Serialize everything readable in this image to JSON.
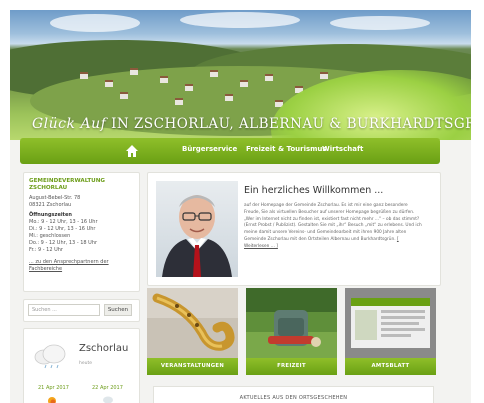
{
  "header": {
    "title_script": "Glück Auf",
    "title_rest": "in Zschorlau, Albernau & Burkhardtsgrün"
  },
  "nav": {
    "home_icon": "home-icon",
    "items": [
      "Bürgerservice",
      "Freizeit & Tourismus",
      "Wirtschaft"
    ]
  },
  "sidebar": {
    "info": {
      "title": "GEMEINDEVERWALTUNG ZSCHORLAU",
      "address1": "August-Bebel-Str. 78",
      "address2": "08321 Zschorlau",
      "hours_title": "Öffnungszeiten",
      "hours": [
        "Mo.:  9 - 12 Uhr, 13 - 16 Uhr",
        "Di.:   9 - 12 Uhr, 13 - 16 Uhr",
        "Mi.:   geschlossen",
        "Do.:  9 - 12 Uhr, 13 - 18 Uhr",
        "Fr.:   9 - 12 Uhr"
      ],
      "link_line1": "... zu den Ansprechpartnern der",
      "link_line2": "Fachbereiche"
    },
    "search": {
      "placeholder": "Suchen ...",
      "button": "Suchen"
    },
    "weather": {
      "city": "Zschorlau",
      "sub": "heute",
      "date1": "21 Apr 2017",
      "date2": "22 Apr 2017"
    }
  },
  "welcome": {
    "title": "Ein herzliches Willkommen ...",
    "text": "auf der Homepage der Gemeinde Zschorlau. Es ist mir eine ganz besondere Freude, Sie als virtuellen Besucher auf unserer Homepage begrüßen zu dürfen. „Wer im Internet nicht zu finden ist, existiert fast nicht mehr ...“ – ob das stimmt? (Ernst Probst / Publizist). Gestalten Sie mit „ihr“ Besuch „mit“ zu erlebens. Und ich meine damit unsere Vereins- und Gemeindearbeit mit ihren 900 Jahre alten Gemeinde Zschorlau mit den Ortsteilen Albernau und Burkhardtsgrün.",
    "more": "[ Weiterlesen ... ]"
  },
  "tiles": [
    {
      "label": "VERANSTALTUNGEN"
    },
    {
      "label": "FREIZEIT"
    },
    {
      "label": "AMTSBLATT"
    }
  ],
  "news": {
    "title": "AKTUELLES AUS DEN ORTSGESCHEHEN"
  },
  "colors": {
    "accent": "#7cb01f",
    "accent_dark": "#6aa014"
  }
}
